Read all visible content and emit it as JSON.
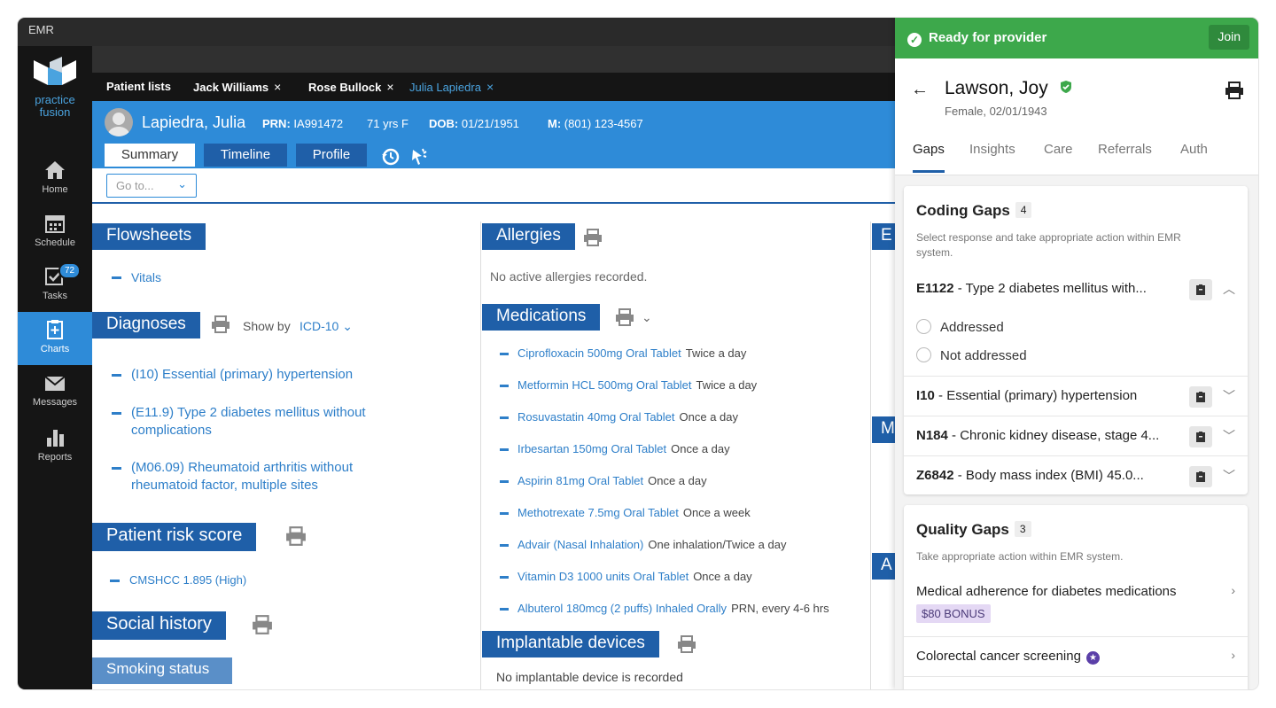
{
  "window": {
    "title": "EMR"
  },
  "sidebar": {
    "logo_line1": "practice",
    "logo_line2": "fusion",
    "items": [
      {
        "label": "Home",
        "icon": "home-icon"
      },
      {
        "label": "Schedule",
        "icon": "calendar-icon"
      },
      {
        "label": "Tasks",
        "icon": "tasks-icon",
        "badge": "72"
      },
      {
        "label": "Charts",
        "icon": "charts-icon",
        "active": true
      },
      {
        "label": "Messages",
        "icon": "envelope-icon"
      },
      {
        "label": "Reports",
        "icon": "bar-chart-icon"
      }
    ]
  },
  "tabs": [
    {
      "label": "Patient lists"
    },
    {
      "label": "Jack Williams",
      "close": "×"
    },
    {
      "label": "Rose Bullock",
      "close": "×"
    },
    {
      "label": "Julia Lapiedra",
      "close": "×",
      "active": true
    }
  ],
  "patient": {
    "name": "Lapiedra, Julia",
    "prn_label": "PRN:",
    "prn": "IA991472",
    "age": "71 yrs F",
    "dob_label": "DOB:",
    "dob": "01/21/1951",
    "phone_label": "M:",
    "phone": "(801) 123-4567"
  },
  "subtabs": [
    "Summary",
    "Timeline",
    "Profile"
  ],
  "goto": {
    "label": "Go to..."
  },
  "flowsheets": {
    "title": "Flowsheets",
    "items": [
      "Vitals"
    ]
  },
  "diagnoses": {
    "title": "Diagnoses",
    "show_by_label": "Show by",
    "show_by_value": "ICD-10",
    "items": [
      [
        "(I10) Essential (primary) hypertension"
      ],
      [
        "(E11.9) Type 2 diabetes mellitus without",
        "complications"
      ],
      [
        "(M06.09) Rheumatoid arthritis without",
        "rheumatoid factor, multiple sites"
      ]
    ]
  },
  "risk": {
    "title": "Patient risk score",
    "items": [
      "CMSHCC 1.895 (High)"
    ]
  },
  "social": {
    "title": "Social history",
    "smoking": "Smoking status"
  },
  "allergies": {
    "title": "Allergies",
    "empty": "No active allergies recorded."
  },
  "medications": {
    "title": "Medications",
    "items": [
      {
        "name": "Ciprofloxacin 500mg Oral Tablet",
        "freq": "Twice a day"
      },
      {
        "name": "Metformin HCL 500mg Oral Tablet",
        "freq": "Twice a day"
      },
      {
        "name": "Rosuvastatin 40mg Oral Tablet",
        "freq": "Once a day"
      },
      {
        "name": "Irbesartan 150mg Oral Tablet",
        "freq": "Once a day"
      },
      {
        "name": "Aspirin 81mg Oral Tablet",
        "freq": "Once a day"
      },
      {
        "name": "Methotrexate 7.5mg Oral Tablet",
        "freq": "Once a week"
      },
      {
        "name": "Advair (Nasal Inhalation)",
        "freq": "One inhalation/Twice a day"
      },
      {
        "name": "Vitamin D3 1000 units Oral Tablet",
        "freq": "Once a day"
      },
      {
        "name": "Albuterol 180mcg (2 puffs) Inhaled Orally",
        "freq": "PRN, every 4-6 hrs"
      }
    ]
  },
  "implants": {
    "title": "Implantable devices",
    "empty": "No implantable device is recorded"
  },
  "col3_letters": [
    "E",
    "M",
    "A"
  ],
  "panel": {
    "status": "Ready for provider",
    "join": "Join",
    "name": "Lawson, Joy",
    "sub": "Female, 02/01/1943",
    "tabs": [
      "Gaps",
      "Insights",
      "Care",
      "Referrals",
      "Auth"
    ],
    "coding": {
      "title": "Coding Gaps",
      "count": "4",
      "desc": "Select response and take appropriate action within EMR system.",
      "items": [
        {
          "code": "E1122",
          "text": " - Type 2 diabetes mellitus with..."
        },
        {
          "code": "I10",
          "text": " - Essential (primary) hypertension"
        },
        {
          "code": "N184",
          "text": " - Chronic kidney disease, stage 4..."
        },
        {
          "code": "Z6842",
          "text": " - Body mass index (BMI) 45.0..."
        }
      ],
      "options": [
        "Addressed",
        "Not addressed"
      ]
    },
    "quality": {
      "title": "Quality Gaps",
      "count": "3",
      "desc": "Take appropriate action within EMR system.",
      "items": [
        {
          "text": "Medical adherence for diabetes medications",
          "bonus": "$80 BONUS"
        },
        {
          "text": "Colorectal cancer screening"
        }
      ]
    }
  }
}
